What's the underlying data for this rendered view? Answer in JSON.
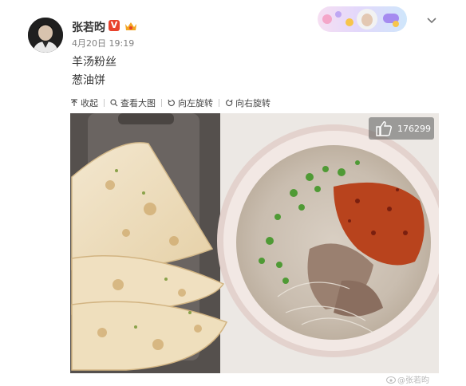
{
  "post": {
    "username": "张若昀",
    "verified_badge": "V",
    "time": "4月20日 19:19",
    "text_lines": [
      "羊汤粉丝",
      "葱油饼"
    ]
  },
  "toolbar": {
    "collapse": "收起",
    "view_large": "查看大图",
    "rotate_left": "向左旋转",
    "rotate_right": "向右旋转"
  },
  "image": {
    "like_count": "176299",
    "watermark": "@张若昀"
  },
  "colors": {
    "badge_red": "#e8422c",
    "text_dark": "#333333",
    "text_gray": "#808080"
  },
  "icons": [
    "avatar",
    "verified-v-badge",
    "member-crown-icon",
    "chevron-down-icon",
    "collapse-icon",
    "zoom-icon",
    "rotate-left-icon",
    "rotate-right-icon",
    "thumbs-up-icon",
    "weibo-logo-icon"
  ]
}
